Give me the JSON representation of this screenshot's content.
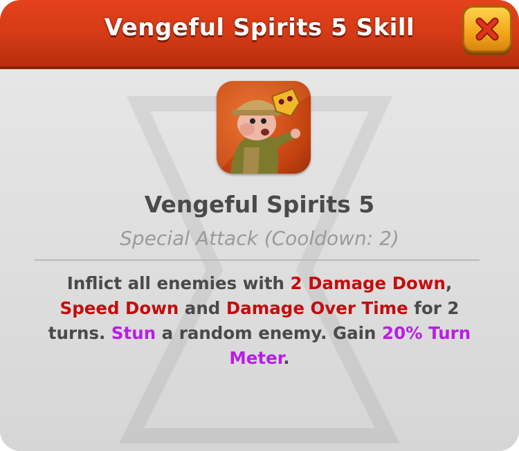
{
  "header": {
    "title": "Vengeful Spirits 5 Skill"
  },
  "skill": {
    "name": "Vengeful Spirits 5",
    "type": "Special Attack (Cooldown: 2)",
    "icon": "character-portrait-icon"
  },
  "description": {
    "t1": "Inflict all enemies with ",
    "k1": "2 Damage Down",
    "t2": ",",
    "k2": "Speed Down",
    "t3": " and ",
    "k3": "Damage Over Time",
    "t4": " for 2 turns. ",
    "k4": "Stun",
    "t5": " a random enemy. Gain ",
    "k5": "20% Turn Meter",
    "t6": "."
  },
  "colors": {
    "header": "#d33a15",
    "debuff": "#c40d0d",
    "buff": "#b91ee6",
    "close_button": "#f2a51a"
  }
}
